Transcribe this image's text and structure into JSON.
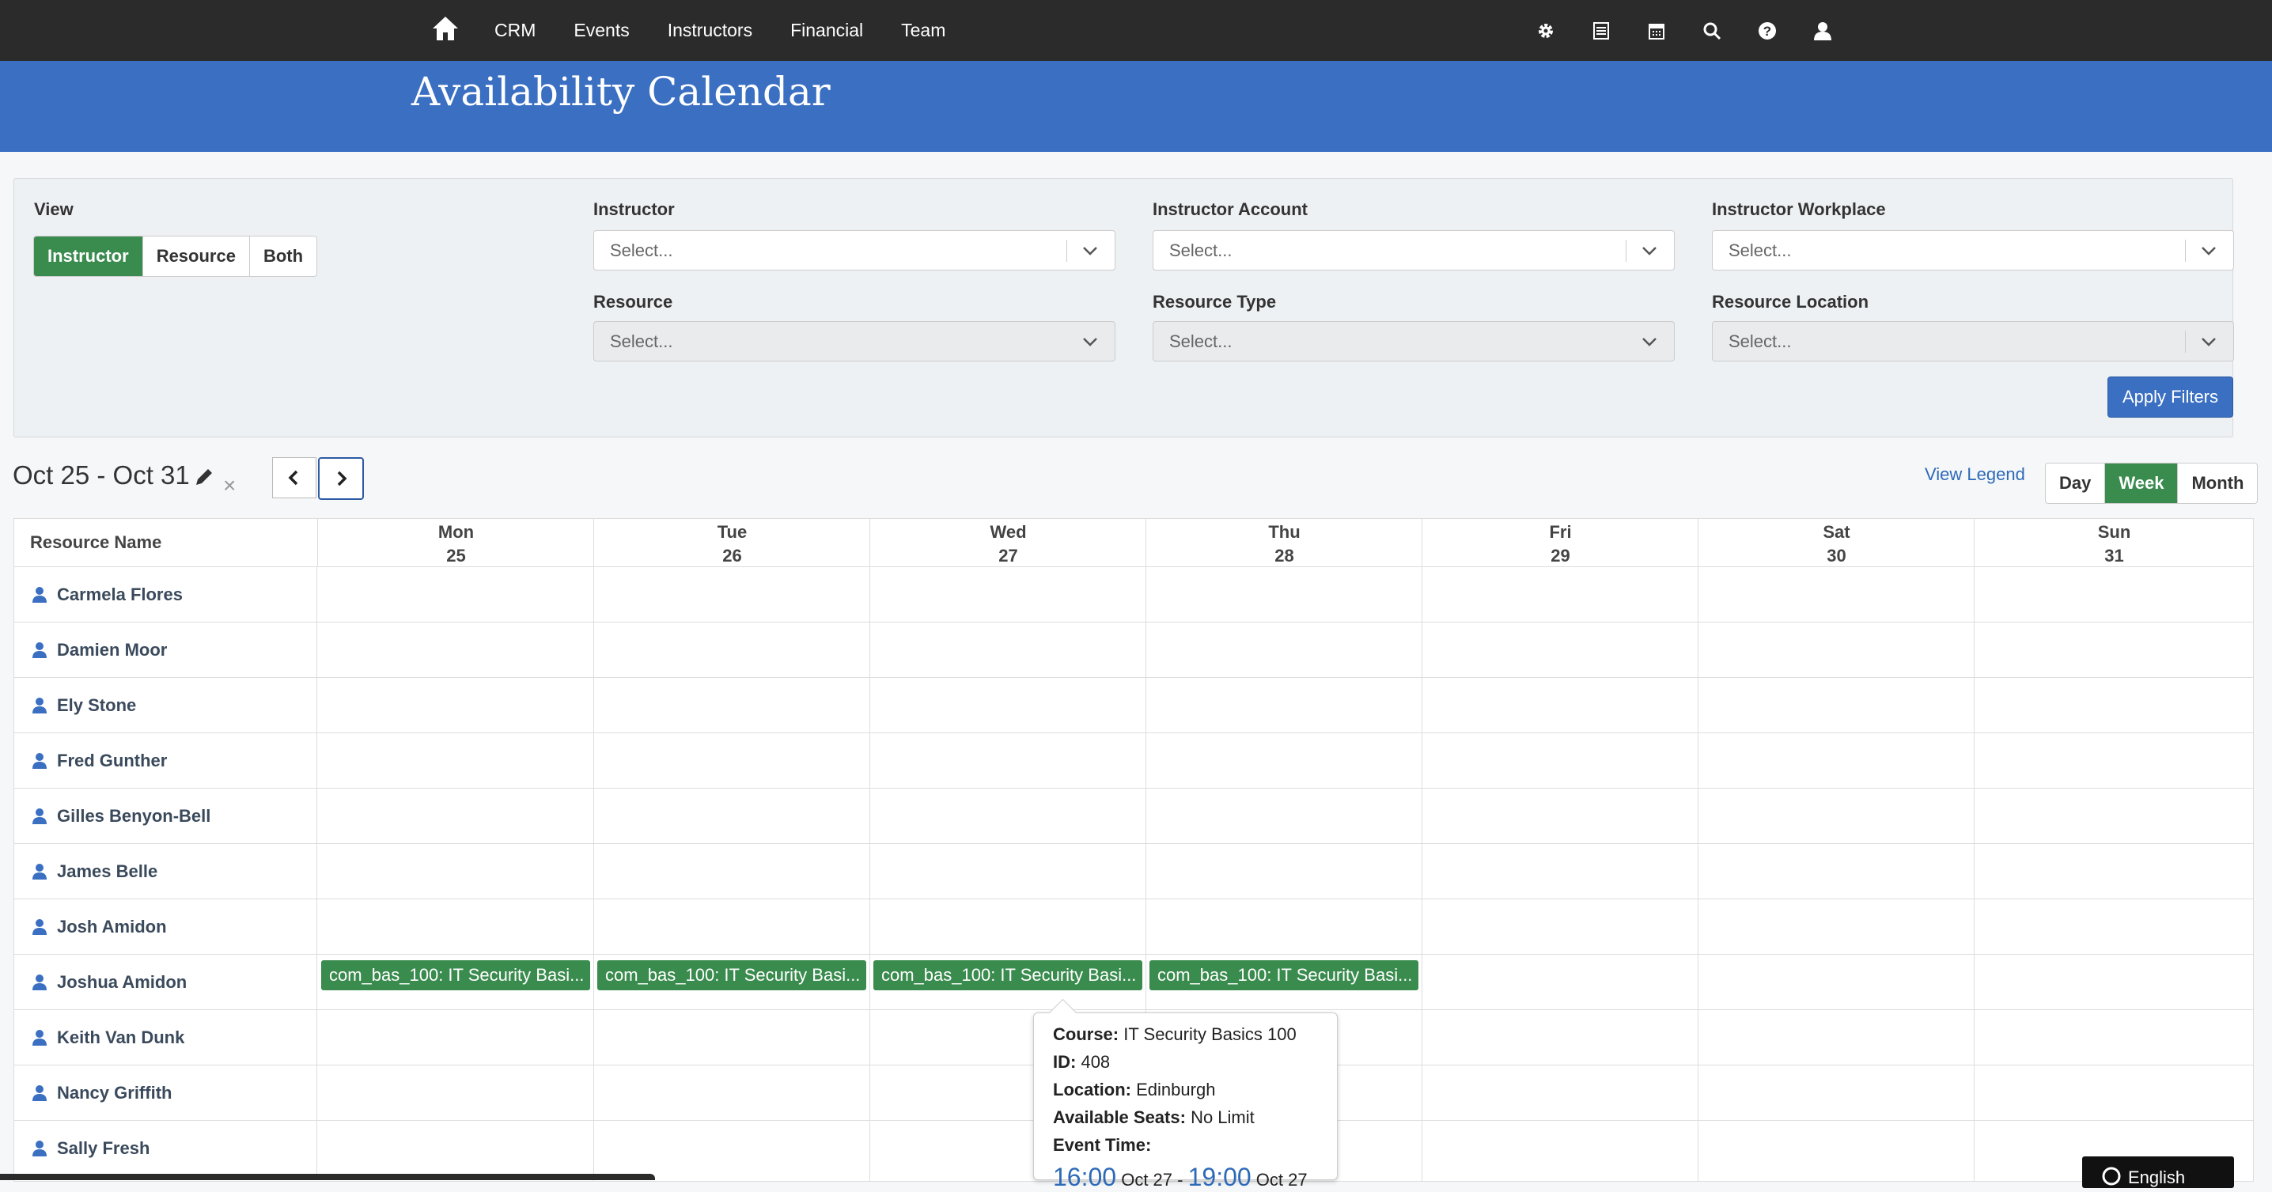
{
  "nav": {
    "items": [
      "CRM",
      "Events",
      "Instructors",
      "Financial",
      "Team"
    ],
    "tools": [
      "gear-icon",
      "list-icon",
      "calendar-icon",
      "search-icon",
      "help-icon",
      "user-icon"
    ]
  },
  "header": {
    "title": "Availability Calendar"
  },
  "filters": {
    "view_label": "View",
    "view_options": [
      "Instructor",
      "Resource",
      "Both"
    ],
    "view_selected": "Instructor",
    "instructor_label": "Instructor",
    "instructor_account_label": "Instructor Account",
    "instructor_workplace_label": "Instructor Workplace",
    "resource_label": "Resource",
    "resource_type_label": "Resource Type",
    "resource_location_label": "Resource Location",
    "placeholder": "Select...",
    "apply_label": "Apply Filters"
  },
  "calendar": {
    "range": "Oct 25 - Oct 31",
    "clear": "×",
    "legend_link": "View Legend",
    "view_modes": [
      "Day",
      "Week",
      "Month"
    ],
    "view_mode_selected": "Week",
    "resource_header": "Resource Name",
    "days": [
      {
        "name": "Mon",
        "date": "25"
      },
      {
        "name": "Tue",
        "date": "26"
      },
      {
        "name": "Wed",
        "date": "27"
      },
      {
        "name": "Thu",
        "date": "28"
      },
      {
        "name": "Fri",
        "date": "29"
      },
      {
        "name": "Sat",
        "date": "30"
      },
      {
        "name": "Sun",
        "date": "31"
      }
    ],
    "resources": [
      "Carmela Flores",
      "Damien Moor",
      "Ely Stone",
      "Fred Gunther",
      "Gilles Benyon-Bell",
      "James Belle",
      "Josh Amidon",
      "Joshua Amidon",
      "Keith Van Dunk",
      "Nancy Griffith",
      "Sally Fresh"
    ],
    "event_label": "com_bas_100: IT Security Basi..."
  },
  "tooltip": {
    "course_label": "Course:",
    "course": "IT Security Basics 100",
    "id_label": "ID:",
    "id": "408",
    "location_label": "Location:",
    "location": "Edinburgh",
    "seats_label": "Available Seats:",
    "seats": "No Limit",
    "time_label": "Event Time:",
    "start_time": "16:00",
    "start_date": "Oct 27",
    "dash": "-",
    "end_time": "19:00",
    "end_date": "Oct 27"
  },
  "language": {
    "label": "English"
  },
  "colors": {
    "header_blue": "#3a6fc2",
    "event_green": "#3a8b4e",
    "nav_dark": "#2b2b2b"
  }
}
